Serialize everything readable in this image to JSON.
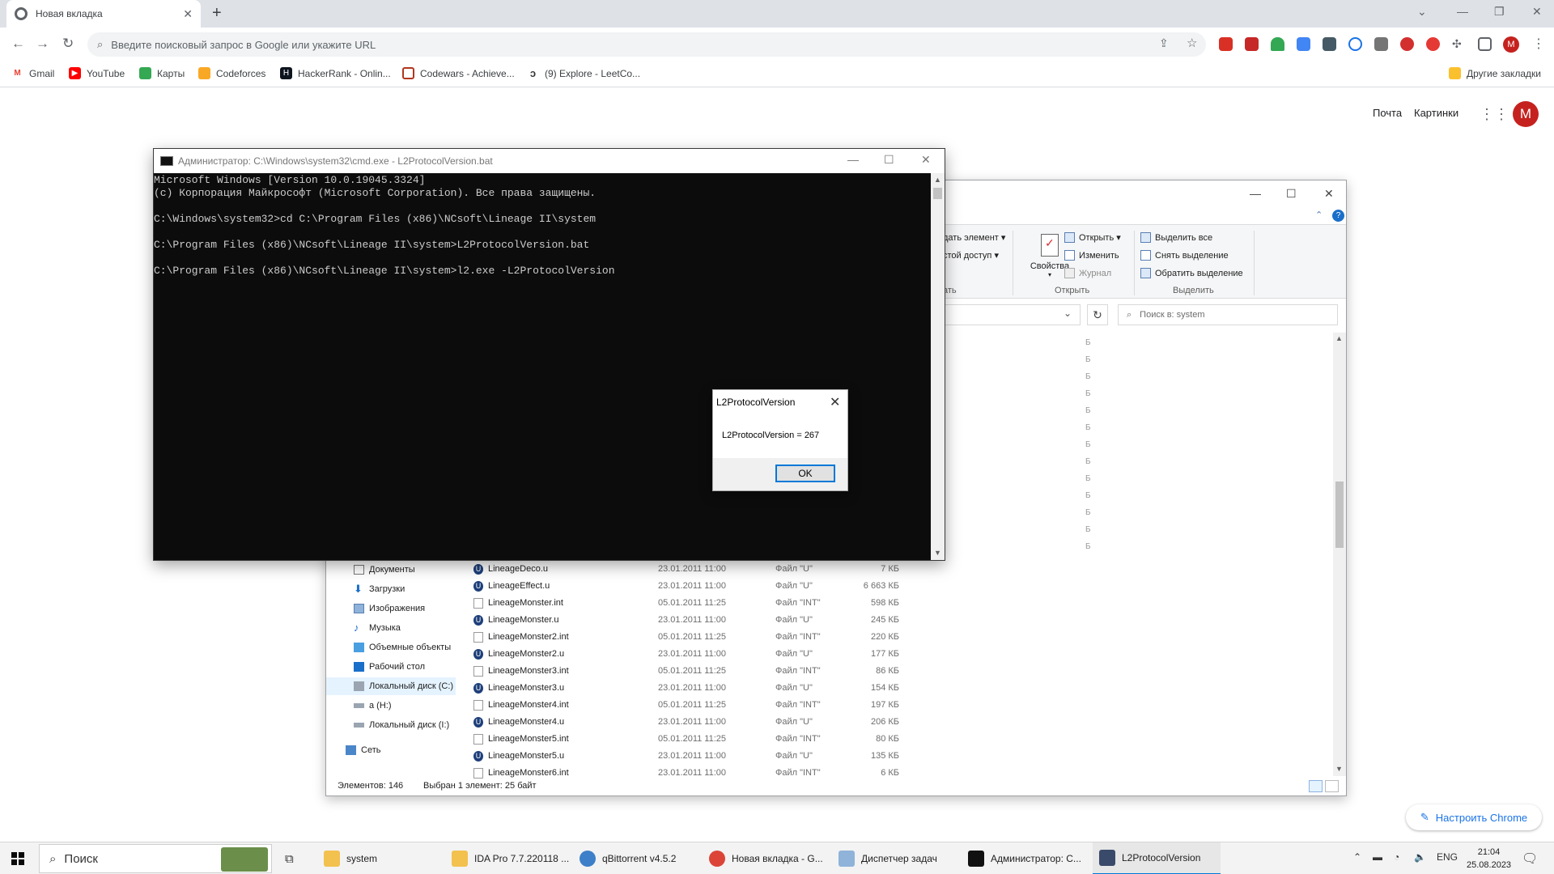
{
  "chrome": {
    "tab_title": "Новая вкладка",
    "tab_close": "✕",
    "new_tab": "+",
    "omnibox_placeholder": "Введите поисковый запрос в Google или укажите URL",
    "profile_initial": "M",
    "bookmarks": [
      "Gmail",
      "YouTube",
      "Карты",
      "Codeforces",
      "HackerRank - Onlin...",
      "Codewars - Achieve...",
      "(9) Explore - LeetCo..."
    ],
    "other_bookmarks": "Другие закладки",
    "google_links": {
      "mail": "Почта",
      "images": "Картинки"
    },
    "avatar_initial": "M",
    "customize": "Настроить Chrome"
  },
  "cmd": {
    "title": "Администратор: C:\\Windows\\system32\\cmd.exe - L2ProtocolVersion.bat",
    "lines": [
      "Microsoft Windows [Version 10.0.19045.3324]",
      "(c) Корпорация Майкрософт (Microsoft Corporation). Все права защищены.",
      "",
      "C:\\Windows\\system32>cd C:\\Program Files (x86)\\NCsoft\\Lineage II\\system",
      "",
      "C:\\Program Files (x86)\\NCsoft\\Lineage II\\system>L2ProtocolVersion.bat",
      "",
      "C:\\Program Files (x86)\\NCsoft\\Lineage II\\system>l2.exe -L2ProtocolVersion"
    ]
  },
  "msgbox": {
    "title": "L2ProtocolVersion",
    "text": "L2ProtocolVersion = 267",
    "ok": "OK"
  },
  "explorer": {
    "ribbon": {
      "create_element": "дать элемент ▾",
      "easy_access": "стой доступ ▾",
      "create_group_label": "ать",
      "properties": "Свойства",
      "open": "Открыть ▾",
      "edit": "Изменить",
      "history": "Журнал",
      "open_group": "Открыть",
      "select_all": "Выделить все",
      "select_none": "Снять выделение",
      "invert_selection": "Обратить выделение",
      "select_group": "Выделить"
    },
    "search_placeholder": "Поиск в: system",
    "nav": [
      "Документы",
      "Загрузки",
      "Изображения",
      "Музыка",
      "Объемные объекты",
      "Рабочий стол",
      "Локальный диск (C:)",
      "a (H:)",
      "Локальный диск (I:)",
      "Сеть"
    ],
    "files": [
      {
        "name": "LineageDeco.u",
        "date": "23.01.2011 11:00",
        "type": "Файл \"U\"",
        "size": "7 КБ",
        "kind": "u"
      },
      {
        "name": "LineageEffect.u",
        "date": "23.01.2011 11:00",
        "type": "Файл \"U\"",
        "size": "6 663 КБ",
        "kind": "u"
      },
      {
        "name": "LineageMonster.int",
        "date": "05.01.2011 11:25",
        "type": "Файл \"INT\"",
        "size": "598 КБ",
        "kind": "t"
      },
      {
        "name": "LineageMonster.u",
        "date": "23.01.2011 11:00",
        "type": "Файл \"U\"",
        "size": "245 КБ",
        "kind": "u"
      },
      {
        "name": "LineageMonster2.int",
        "date": "05.01.2011 11:25",
        "type": "Файл \"INT\"",
        "size": "220 КБ",
        "kind": "t"
      },
      {
        "name": "LineageMonster2.u",
        "date": "23.01.2011 11:00",
        "type": "Файл \"U\"",
        "size": "177 КБ",
        "kind": "u"
      },
      {
        "name": "LineageMonster3.int",
        "date": "05.01.2011 11:25",
        "type": "Файл \"INT\"",
        "size": "86 КБ",
        "kind": "t"
      },
      {
        "name": "LineageMonster3.u",
        "date": "23.01.2011 11:00",
        "type": "Файл \"U\"",
        "size": "154 КБ",
        "kind": "u"
      },
      {
        "name": "LineageMonster4.int",
        "date": "05.01.2011 11:25",
        "type": "Файл \"INT\"",
        "size": "197 КБ",
        "kind": "t"
      },
      {
        "name": "LineageMonster4.u",
        "date": "23.01.2011 11:00",
        "type": "Файл \"U\"",
        "size": "206 КБ",
        "kind": "u"
      },
      {
        "name": "LineageMonster5.int",
        "date": "05.01.2011 11:25",
        "type": "Файл \"INT\"",
        "size": "80 КБ",
        "kind": "t"
      },
      {
        "name": "LineageMonster5.u",
        "date": "23.01.2011 11:00",
        "type": "Файл \"U\"",
        "size": "135 КБ",
        "kind": "u"
      },
      {
        "name": "LineageMonster6.int",
        "date": "23.01.2011 11:00",
        "type": "Файл \"INT\"",
        "size": "6 КБ",
        "kind": "t"
      }
    ],
    "status_count": "Элементов: 146",
    "status_selected": "Выбран 1 элемент: 25 байт"
  },
  "taskbar": {
    "search": "Поиск",
    "items": [
      "system",
      "IDA Pro 7.7.220118 ...",
      "qBittorrent v4.5.2",
      "Новая вкладка - G...",
      "Диспетчер задач",
      "Администратор: C...",
      "L2ProtocolVersion"
    ],
    "lang": "ENG",
    "time": "21:04",
    "date": "25.08.2023"
  },
  "colors": {
    "accent": "#0078d7",
    "chrome_red": "#c5221f",
    "link_blue": "#1a73e8"
  }
}
